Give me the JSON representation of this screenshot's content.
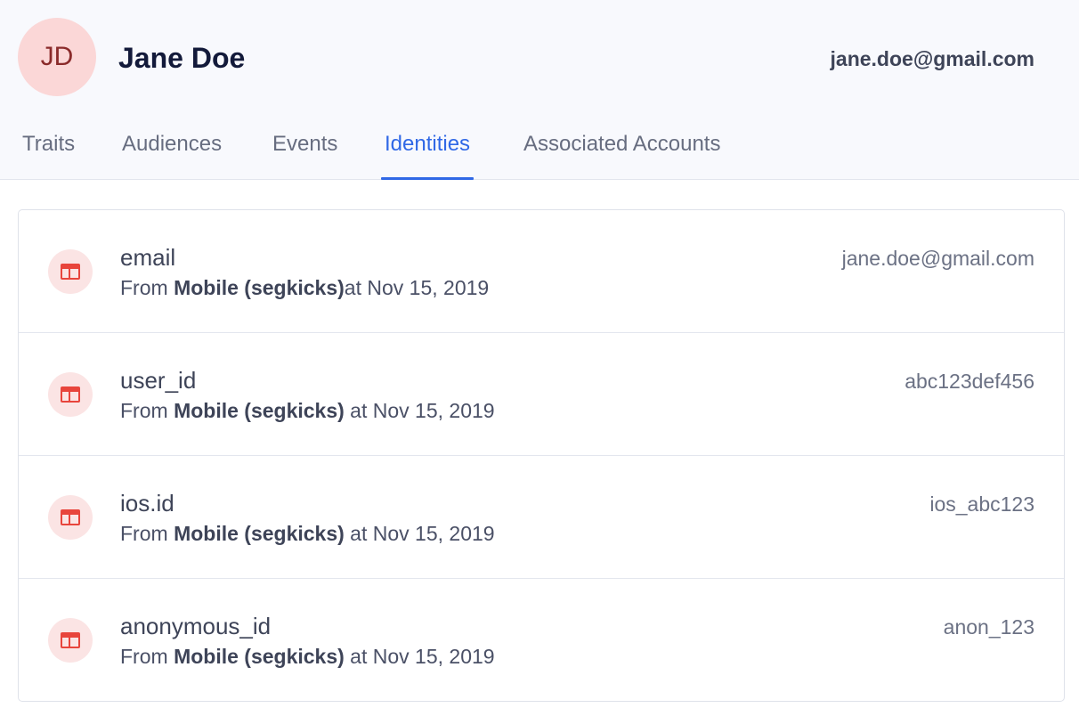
{
  "profile": {
    "initials": "JD",
    "name": "Jane Doe",
    "email": "jane.doe@gmail.com"
  },
  "tabs": [
    {
      "label": "Traits",
      "active": false
    },
    {
      "label": "Audiences",
      "active": false
    },
    {
      "label": "Events",
      "active": false
    },
    {
      "label": "Identities",
      "active": true
    },
    {
      "label": "Associated Accounts",
      "active": false
    }
  ],
  "identities": [
    {
      "key": "email",
      "from_prefix": "From ",
      "source": "Mobile (segkicks)",
      "at_text": "at Nov 15, 2019",
      "value": "jane.doe@gmail.com",
      "icon": "source-table-icon"
    },
    {
      "key": "user_id",
      "from_prefix": "From ",
      "source": "Mobile (segkicks)",
      "at_text": " at Nov 15, 2019",
      "value": "abc123def456",
      "icon": "source-table-icon"
    },
    {
      "key": "ios.id",
      "from_prefix": "From ",
      "source": "Mobile (segkicks)",
      "at_text": " at Nov 15, 2019",
      "value": "ios_abc123",
      "icon": "source-table-icon"
    },
    {
      "key": "anonymous_id",
      "from_prefix": "From ",
      "source": "Mobile (segkicks)",
      "at_text": " at Nov 15, 2019",
      "value": "anon_123",
      "icon": "source-table-icon"
    }
  ],
  "colors": {
    "accent": "#3068e6",
    "icon": "#e8453c",
    "icon_bg": "#fbe4e4",
    "avatar_bg": "#fbd7d7"
  }
}
